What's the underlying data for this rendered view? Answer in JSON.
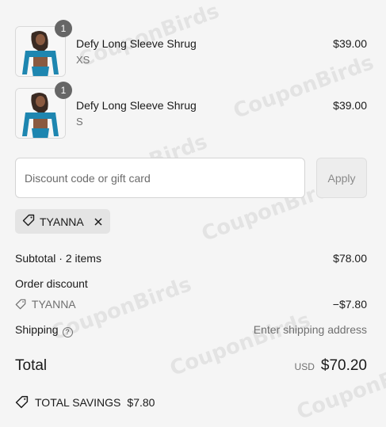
{
  "items": [
    {
      "title": "Defy Long Sleeve Shrug",
      "variant": "XS",
      "price": "$39.00",
      "quantity": "1",
      "image_icon": "product-photo"
    },
    {
      "title": "Defy Long Sleeve Shrug",
      "variant": "S",
      "price": "$39.00",
      "quantity": "1",
      "image_icon": "product-photo"
    }
  ],
  "discount": {
    "placeholder": "Discount code or gift card",
    "value": "",
    "apply_label": "Apply",
    "applied_code": "TYANNA"
  },
  "summary": {
    "subtotal_label": "Subtotal · 2 items",
    "subtotal_value": "$78.00",
    "order_discount_label": "Order discount",
    "discount_code": "TYANNA",
    "discount_value": "−$7.80",
    "shipping_label": "Shipping",
    "shipping_value": "Enter shipping address",
    "total_label": "Total",
    "currency": "USD",
    "total_value": "$70.20",
    "savings_label": "TOTAL SAVINGS",
    "savings_value": "$7.80"
  },
  "watermark": "CouponBirds",
  "colors": {
    "background": "#f5f5f5",
    "badge": "#666666",
    "chip": "#e4e4e4",
    "muted_text": "#707070"
  }
}
